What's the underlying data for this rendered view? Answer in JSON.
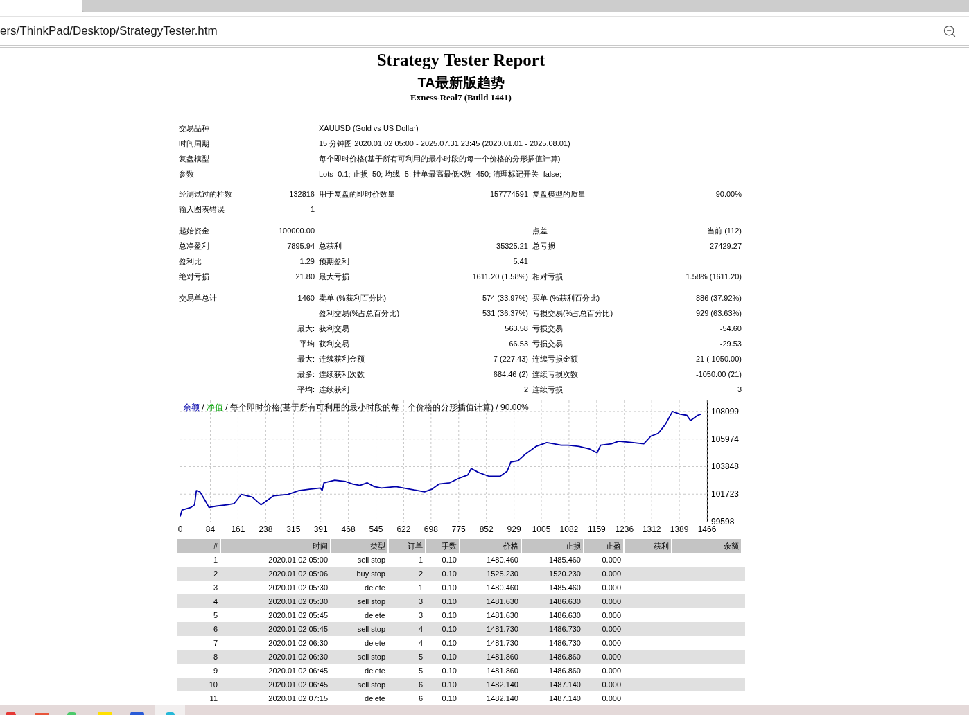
{
  "browser": {
    "address": "ers/ThinkPad/Desktop/StrategyTester.htm"
  },
  "report": {
    "title": "Strategy Tester Report",
    "expert": "TA最新版趋势",
    "server": "Exness-Real7 (Build 1441)"
  },
  "settings": [
    {
      "label": "交易品种",
      "value": "XAUUSD (Gold vs US Dollar)"
    },
    {
      "label": "时间周期",
      "value": "15 分钟图 2020.01.02 05:00 - 2025.07.31 23:45 (2020.01.01 - 2025.08.01)"
    },
    {
      "label": "复盘模型",
      "value": "每个即时价格(基于所有可利用的最小时段的每一个价格的分形插值计算)"
    },
    {
      "label": "参数",
      "value": "Lots=0.1; 止损=50; 均线=5; 挂单最高最低K数=450; 清理标记开关=false;"
    }
  ],
  "summary_groups": [
    [
      {
        "label_1": "经测试过的柱数",
        "value_1": "132816",
        "label_2": "用于复盘的即时价数量",
        "value_2": "157774591",
        "label_3": "复盘模型的质量",
        "value_3": "90.00%"
      },
      {
        "label_1": "输入图表错误",
        "value_1": "1"
      }
    ],
    [
      {
        "label_1": "起始资金",
        "value_1": "100000.00",
        "label_3": "点差",
        "value_3": "当前 (112)"
      },
      {
        "label_1": "总净盈利",
        "value_1": "7895.94",
        "label_2": "总获利",
        "value_2": "35325.21",
        "label_3": "总亏损",
        "value_3": "-27429.27"
      },
      {
        "label_1": "盈利比",
        "value_1": "1.29",
        "label_2": "预期盈利",
        "value_2": "5.41"
      },
      {
        "label_1": "绝对亏损",
        "value_1": "21.80",
        "label_2": "最大亏损",
        "value_2": "1611.20 (1.58%)",
        "label_3": "相对亏损",
        "value_3": "1.58% (1611.20)"
      }
    ],
    [
      {
        "label_1": "交易单总计",
        "value_1": "1460",
        "label_2": "卖单 (%获利百分比)",
        "value_2": "574 (33.97%)",
        "label_3": "买单 (%获利百分比)",
        "value_3": "886 (37.92%)"
      },
      {
        "label_2": "盈利交易(%占总百分比)",
        "value_2": "531 (36.37%)",
        "label_3": "亏损交易(%占总百分比)",
        "value_3": "929 (63.63%)"
      },
      {
        "qualifier": "最大:",
        "label_2": "获利交易",
        "value_2": "563.58",
        "label_3": "亏损交易",
        "value_3": "-54.60"
      },
      {
        "qualifier": "平均",
        "label_2": "获利交易",
        "value_2": "66.53",
        "label_3": "亏损交易",
        "value_3": "-29.53"
      },
      {
        "qualifier": "最大:",
        "label_2": "连续获利金额",
        "value_2": "7 (227.43)",
        "label_3": "连续亏损金额",
        "value_3": "21 (-1050.00)"
      },
      {
        "qualifier": "最多:",
        "label_2": "连续获利次数",
        "value_2": "684.46 (2)",
        "label_3": "连续亏损次数",
        "value_3": "-1050.00 (21)"
      },
      {
        "qualifier": "平均:",
        "label_2": "连续获利",
        "value_2": "2",
        "label_3": "连续亏损",
        "value_3": "3"
      }
    ]
  ],
  "chart": {
    "legend": [
      {
        "kind": "separator",
        "text": "/"
      },
      {
        "kind": "series",
        "text": "净值",
        "color": "#00a000"
      },
      {
        "kind": "separator",
        "text": "/"
      },
      {
        "kind": "text",
        "text": "每个即时价格(基于所有可利用的最小时段的每一个价格的分形插值计算)"
      },
      {
        "kind": "separator",
        "text": "/"
      },
      {
        "kind": "text",
        "text": "90.00%"
      }
    ],
    "chart_data": {
      "type": "line",
      "grid": true,
      "x": [
        0,
        5,
        30,
        40,
        45,
        55,
        70,
        80,
        100,
        130,
        150,
        170,
        200,
        225,
        240,
        260,
        300,
        330,
        360,
        390,
        395,
        400,
        430,
        460,
        480,
        500,
        520,
        540,
        560,
        600,
        640,
        680,
        700,
        720,
        750,
        780,
        800,
        810,
        830,
        860,
        890,
        910,
        920,
        940,
        960,
        990,
        1020,
        1040,
        1060,
        1080,
        1110,
        1140,
        1160,
        1170,
        1200,
        1220,
        1260,
        1290,
        1310,
        1330,
        1350,
        1370,
        1390,
        1410,
        1420,
        1440,
        1450
      ],
      "series": [
        {
          "name": "余额",
          "color": "#0000aa",
          "values": [
            100000,
            100500,
            100700,
            100900,
            102000,
            101900,
            101200,
            100700,
            100800,
            100900,
            101000,
            101700,
            101500,
            100900,
            101200,
            101600,
            101700,
            102000,
            102100,
            102200,
            102000,
            102600,
            102800,
            102700,
            102500,
            102400,
            102600,
            102300,
            102200,
            102300,
            102100,
            101900,
            102100,
            102500,
            102600,
            103000,
            103200,
            103700,
            103400,
            103100,
            103100,
            103500,
            104200,
            104300,
            104800,
            105400,
            105700,
            105600,
            105500,
            105500,
            105400,
            105200,
            104900,
            105500,
            105600,
            105800,
            105700,
            105600,
            106200,
            106400,
            107100,
            108100,
            107900,
            107800,
            107400,
            107800,
            107900
          ]
        }
      ],
      "xticks": [
        0,
        84,
        161,
        238,
        315,
        391,
        468,
        545,
        622,
        698,
        775,
        852,
        929,
        1005,
        1082,
        1159,
        1236,
        1312,
        1389,
        1466
      ],
      "yticks": [
        99598,
        101723,
        103848,
        105974,
        108099
      ],
      "xlim": [
        0,
        1466
      ],
      "ylim": [
        99598,
        108950
      ]
    }
  },
  "trades": {
    "columns": [
      "#",
      "时间",
      "类型",
      "订单",
      "手数",
      "价格",
      "止损",
      "止盈",
      "获利",
      "余额"
    ],
    "rows": [
      [
        "1",
        "2020.01.02 05:00",
        "sell stop",
        "1",
        "0.10",
        "1480.460",
        "1485.460",
        "0.000"
      ],
      [
        "2",
        "2020.01.02 05:06",
        "buy stop",
        "2",
        "0.10",
        "1525.230",
        "1520.230",
        "0.000"
      ],
      [
        "3",
        "2020.01.02 05:30",
        "delete",
        "1",
        "0.10",
        "1480.460",
        "1485.460",
        "0.000"
      ],
      [
        "4",
        "2020.01.02 05:30",
        "sell stop",
        "3",
        "0.10",
        "1481.630",
        "1486.630",
        "0.000"
      ],
      [
        "5",
        "2020.01.02 05:45",
        "delete",
        "3",
        "0.10",
        "1481.630",
        "1486.630",
        "0.000"
      ],
      [
        "6",
        "2020.01.02 05:45",
        "sell stop",
        "4",
        "0.10",
        "1481.730",
        "1486.730",
        "0.000"
      ],
      [
        "7",
        "2020.01.02 06:30",
        "delete",
        "4",
        "0.10",
        "1481.730",
        "1486.730",
        "0.000"
      ],
      [
        "8",
        "2020.01.02 06:30",
        "sell stop",
        "5",
        "0.10",
        "1481.860",
        "1486.860",
        "0.000"
      ],
      [
        "9",
        "2020.01.02 06:45",
        "delete",
        "5",
        "0.10",
        "1481.860",
        "1486.860",
        "0.000"
      ],
      [
        "10",
        "2020.01.02 06:45",
        "sell stop",
        "6",
        "0.10",
        "1482.140",
        "1487.140",
        "0.000"
      ],
      [
        "11",
        "2020.01.02 07:15",
        "delete",
        "6",
        "0.10",
        "1482.140",
        "1487.140",
        "0.000"
      ]
    ]
  }
}
